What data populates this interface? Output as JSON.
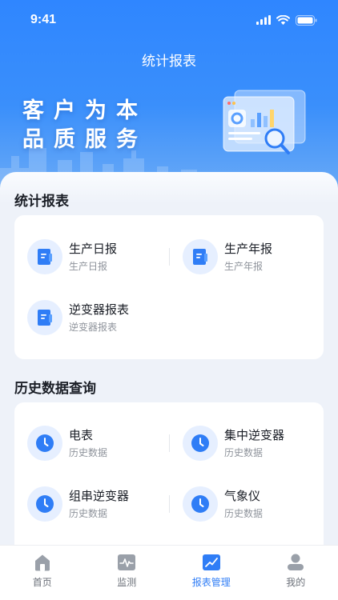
{
  "status_bar": {
    "time": "9:41"
  },
  "header": {
    "title": "统计报表"
  },
  "banner": {
    "slogan_line1": "客户为本",
    "slogan_line2": "品质服务"
  },
  "report_section": {
    "title": "统计报表",
    "items": [
      {
        "title": "生产日报",
        "subtitle": "生产日报",
        "icon": "document-icon"
      },
      {
        "title": "生产年报",
        "subtitle": "生产年报",
        "icon": "document-icon"
      },
      {
        "title": "逆变器报表",
        "subtitle": "逆变器报表",
        "icon": "document-icon"
      }
    ]
  },
  "history_section": {
    "title": "历史数据查询",
    "items": [
      {
        "title": "电表",
        "subtitle": "历史数据",
        "icon": "clock-icon"
      },
      {
        "title": "集中逆变器",
        "subtitle": "历史数据",
        "icon": "clock-icon"
      },
      {
        "title": "组串逆变器",
        "subtitle": "历史数据",
        "icon": "clock-icon"
      },
      {
        "title": "气象仪",
        "subtitle": "历史数据",
        "icon": "clock-icon"
      }
    ]
  },
  "tabbar": {
    "tabs": [
      {
        "label": "首页",
        "icon": "home-icon"
      },
      {
        "label": "监测",
        "icon": "monitor-icon"
      },
      {
        "label": "报表管理",
        "icon": "report-chart-icon",
        "active": true
      },
      {
        "label": "我的",
        "icon": "user-icon"
      }
    ]
  },
  "colors": {
    "accent": "#2f7df6",
    "icon_bg": "#e6efff",
    "hero": "#2f86ff"
  }
}
